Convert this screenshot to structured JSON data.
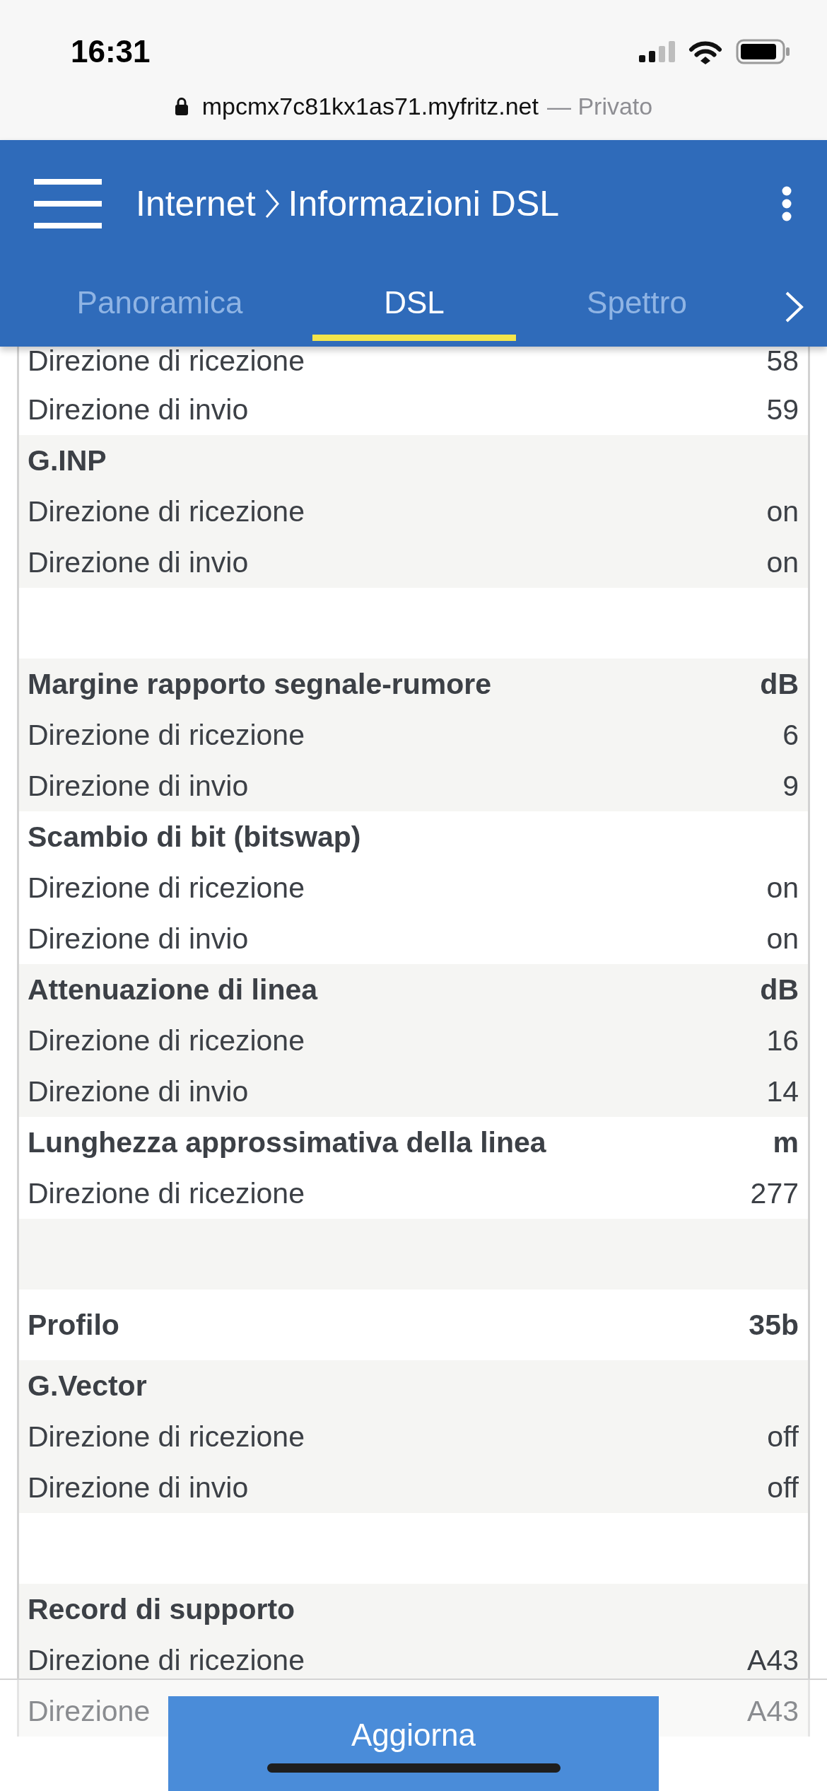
{
  "status_bar": {
    "time": "16:31"
  },
  "address_bar": {
    "url": "mpcmx7c81kx1as71.myfritz.net",
    "label": "— Privato"
  },
  "header": {
    "breadcrumb": [
      "Internet",
      "Informazioni DSL"
    ]
  },
  "tabs": [
    {
      "label": "Panoramica",
      "selected": false
    },
    {
      "label": "DSL",
      "selected": true
    },
    {
      "label": "Spettro",
      "selected": false
    }
  ],
  "table": {
    "groups": [
      {
        "kind": "group",
        "rows": [
          {
            "label": "Direzione di ricezione",
            "value": "58"
          },
          {
            "label": "Direzione di invio",
            "value": "59"
          }
        ]
      },
      {
        "kind": "group",
        "heading": {
          "label": "G.INP"
        },
        "rows": [
          {
            "label": "Direzione di ricezione",
            "value": "on"
          },
          {
            "label": "Direzione di invio",
            "value": "on"
          }
        ]
      },
      {
        "kind": "spacer"
      },
      {
        "kind": "group",
        "heading": {
          "label": "Margine rapporto segnale-rumore",
          "value": "dB"
        },
        "rows": [
          {
            "label": "Direzione di ricezione",
            "value": "6"
          },
          {
            "label": "Direzione di invio",
            "value": "9"
          }
        ]
      },
      {
        "kind": "group",
        "heading": {
          "label": "Scambio di bit (bitswap)"
        },
        "rows": [
          {
            "label": "Direzione di ricezione",
            "value": "on"
          },
          {
            "label": "Direzione di invio",
            "value": "on"
          }
        ]
      },
      {
        "kind": "group",
        "heading": {
          "label": "Attenuazione di linea",
          "value": "dB"
        },
        "rows": [
          {
            "label": "Direzione di ricezione",
            "value": "16"
          },
          {
            "label": "Direzione di invio",
            "value": "14"
          }
        ]
      },
      {
        "kind": "group",
        "heading": {
          "label": "Lunghezza approssimativa della linea",
          "value": "m"
        },
        "rows": [
          {
            "label": "Direzione di ricezione",
            "value": "277"
          }
        ]
      },
      {
        "kind": "spacer"
      },
      {
        "kind": "group",
        "heading": {
          "label": "Profilo",
          "value": "35b"
        }
      },
      {
        "kind": "group",
        "heading": {
          "label": "G.Vector"
        },
        "rows": [
          {
            "label": "Direzione di ricezione",
            "value": "off"
          },
          {
            "label": "Direzione di invio",
            "value": "off"
          }
        ]
      },
      {
        "kind": "spacer"
      },
      {
        "kind": "group",
        "heading": {
          "label": "Record di supporto"
        },
        "rows": [
          {
            "label": "Direzione di ricezione",
            "value": "A43"
          },
          {
            "label": "Direzione",
            "value": "A43"
          }
        ]
      }
    ]
  },
  "footer": {
    "button": "Aggiorna"
  }
}
